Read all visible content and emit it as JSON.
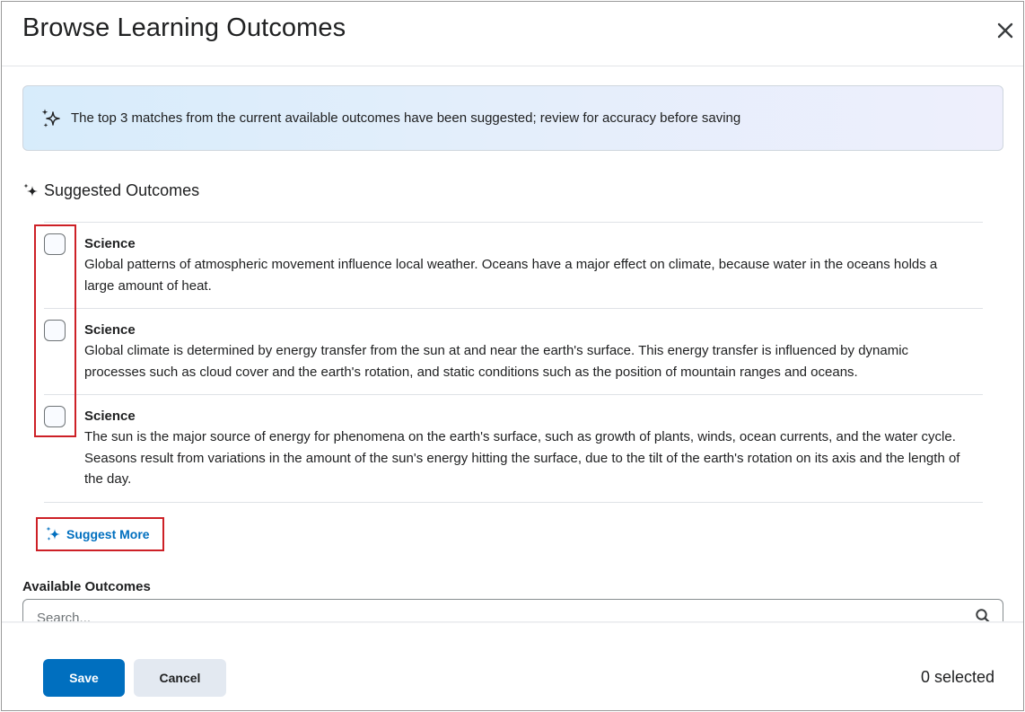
{
  "dialog": {
    "title": "Browse Learning Outcomes",
    "close_label": "Close"
  },
  "banner": {
    "text": "The top 3 matches from the current available outcomes have been suggested; review for accuracy before saving"
  },
  "suggested": {
    "heading": "Suggested Outcomes",
    "items": [
      {
        "title": "Science",
        "description": "Global patterns of atmospheric movement influence local weather. Oceans have a major effect on climate, because water in the oceans holds a large amount of heat.",
        "checked": false
      },
      {
        "title": "Science",
        "description": "Global climate is determined by energy transfer from the sun at and near the earth's surface. This energy transfer is influenced by dynamic processes such as cloud cover and the earth's rotation, and static conditions such as the position of mountain ranges and oceans.",
        "checked": false
      },
      {
        "title": "Science",
        "description": "The sun is the major source of energy for phenomena on the earth's surface, such as growth of plants, winds, ocean currents, and the water cycle. Seasons result from variations in the amount of the sun's energy hitting the surface, due to the tilt of the earth's rotation on its axis and the length of the day.",
        "checked": false
      }
    ],
    "suggest_more_label": "Suggest More"
  },
  "available": {
    "label": "Available Outcomes",
    "search_placeholder": "Search...",
    "search_value": ""
  },
  "footer": {
    "save_label": "Save",
    "cancel_label": "Cancel",
    "selected_text": "0 selected"
  },
  "colors": {
    "primary": "#006fbf",
    "highlight": "#cd2026",
    "cancel_bg": "#e3e9f1",
    "banner_start": "#d7ecfb",
    "banner_end": "#eeeffc"
  },
  "icons": {
    "close": "close-icon",
    "ai_sparkle": "sparkle-icon",
    "search": "search-icon"
  }
}
